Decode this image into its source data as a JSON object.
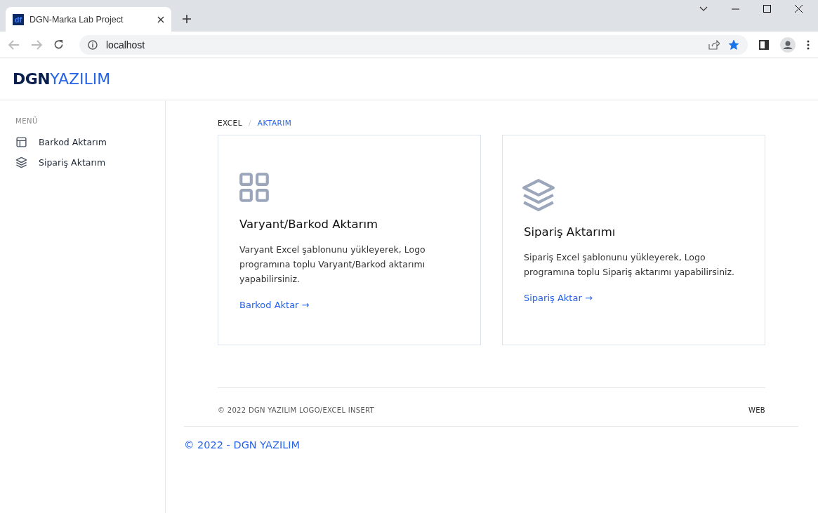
{
  "browser": {
    "tab_title": "DGN-Marka Lab Project",
    "favicon": "df",
    "address": "localhost",
    "bookmarked": true
  },
  "header": {
    "logo_bold": "DGN",
    "logo_light": "YAZILIM"
  },
  "sidebar": {
    "heading": "MENÜ",
    "items": [
      {
        "label": "Barkod Aktarım",
        "kind": "layout"
      },
      {
        "label": "Sipariş Aktarım",
        "kind": "layers"
      }
    ]
  },
  "breadcrumb_separator": "/",
  "breadcrumb": [
    {
      "label": "EXCEL",
      "selected": false
    },
    {
      "label": "AKTARIM",
      "selected": true
    }
  ],
  "cards": [
    {
      "kind": "grid",
      "title": "Varyant/Barkod Aktarım",
      "text": "Varyant Excel şablonunu yükleyerek, Logo programına toplu Varyant/Barkod aktarımı yapabilirsiniz.",
      "link": "Barkod Aktar →"
    },
    {
      "kind": "layers",
      "title": "Sipariş Aktarımı",
      "text": "Sipariş Excel şablonunu yükleyerek, Logo programına toplu Sipariş aktarımı yapabilirsiniz.",
      "link": "Sipariş Aktar →"
    }
  ],
  "footer": {
    "copyright": "© 2022 DGN YAZILIM LOGO/EXCEL INSERT",
    "link": "WEB"
  },
  "page_footer": "© 2022 - DGN YAZILIM"
}
